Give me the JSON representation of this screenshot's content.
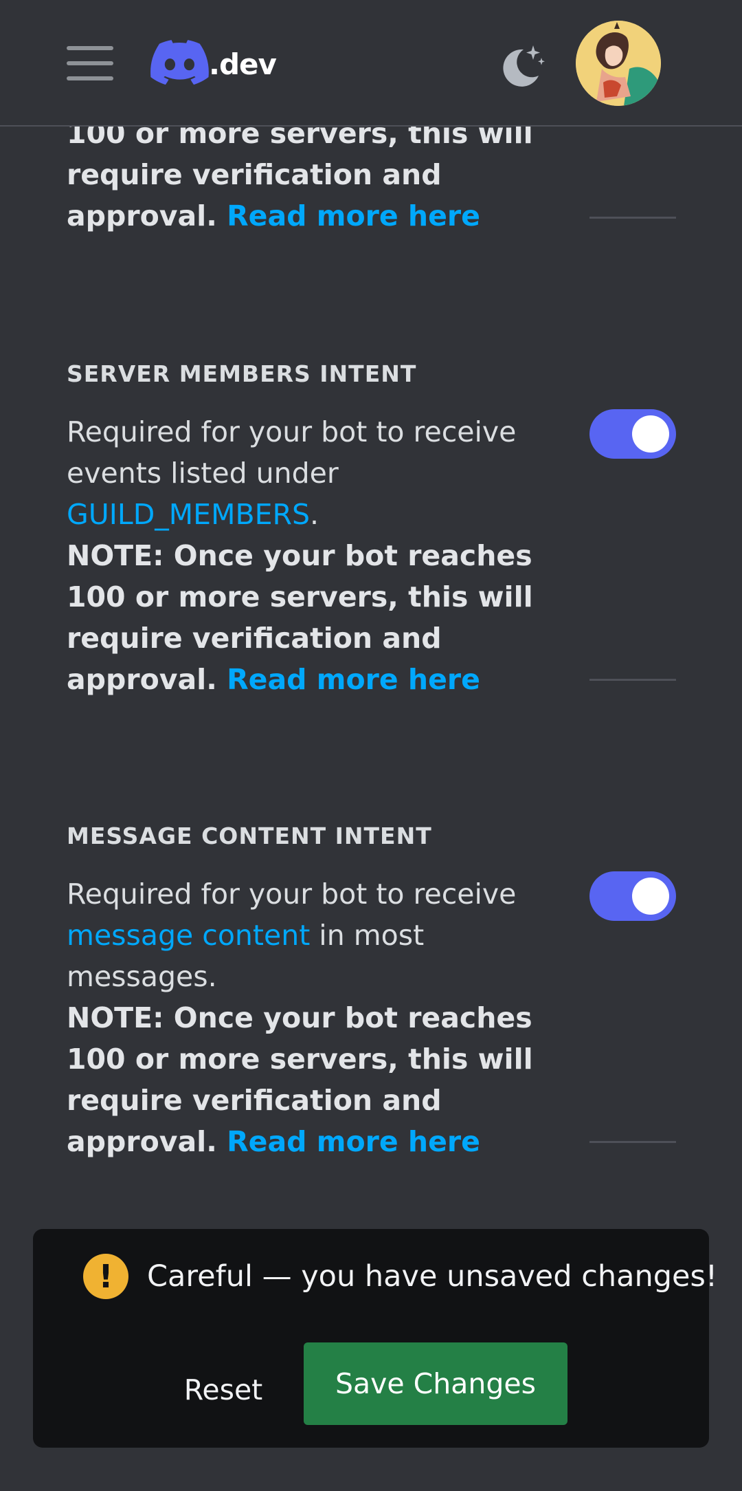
{
  "header": {
    "logo_text": ".dev",
    "icons": [
      "menu-icon",
      "discord-logo-icon",
      "moon-stars-icon",
      "avatar"
    ]
  },
  "intents": [
    {
      "partial": true,
      "note_tail_line1": "100 or more servers, this will",
      "note_tail_line2": "require verification and",
      "note_tail_line3": "approval.",
      "read_more": "Read more here"
    },
    {
      "title": "SERVER MEMBERS INTENT",
      "desc_line1": "Required for your bot to receive",
      "desc_line2": "events listed under",
      "desc_link": "GUILD_MEMBERS",
      "desc_end": ".",
      "note_line1": "NOTE: Once your bot reaches",
      "note_line2": "100 or more servers, this will",
      "note_line3": "require verification and",
      "note_line4": "approval.",
      "read_more": "Read more here",
      "enabled": true
    },
    {
      "title": "MESSAGE CONTENT INTENT",
      "desc_line1": "Required for your bot to receive",
      "desc_link": "message content",
      "desc_after_link": " in most",
      "desc_line3": "messages.",
      "note_line1": "NOTE: Once your bot reaches",
      "note_line2": "100 or more servers, this will",
      "note_line3": "require verification and",
      "note_line4": "approval.",
      "read_more": "Read more here",
      "enabled": true
    }
  ],
  "unsaved_bar": {
    "message": "Careful — you have unsaved changes!",
    "warning_glyph": "!",
    "reset_label": "Reset",
    "save_label": "Save Changes"
  },
  "colors": {
    "background": "#313338",
    "link": "#00a8fc",
    "toggle_on": "#5865f2",
    "save_button": "#248046",
    "warning": "#f0b232"
  }
}
